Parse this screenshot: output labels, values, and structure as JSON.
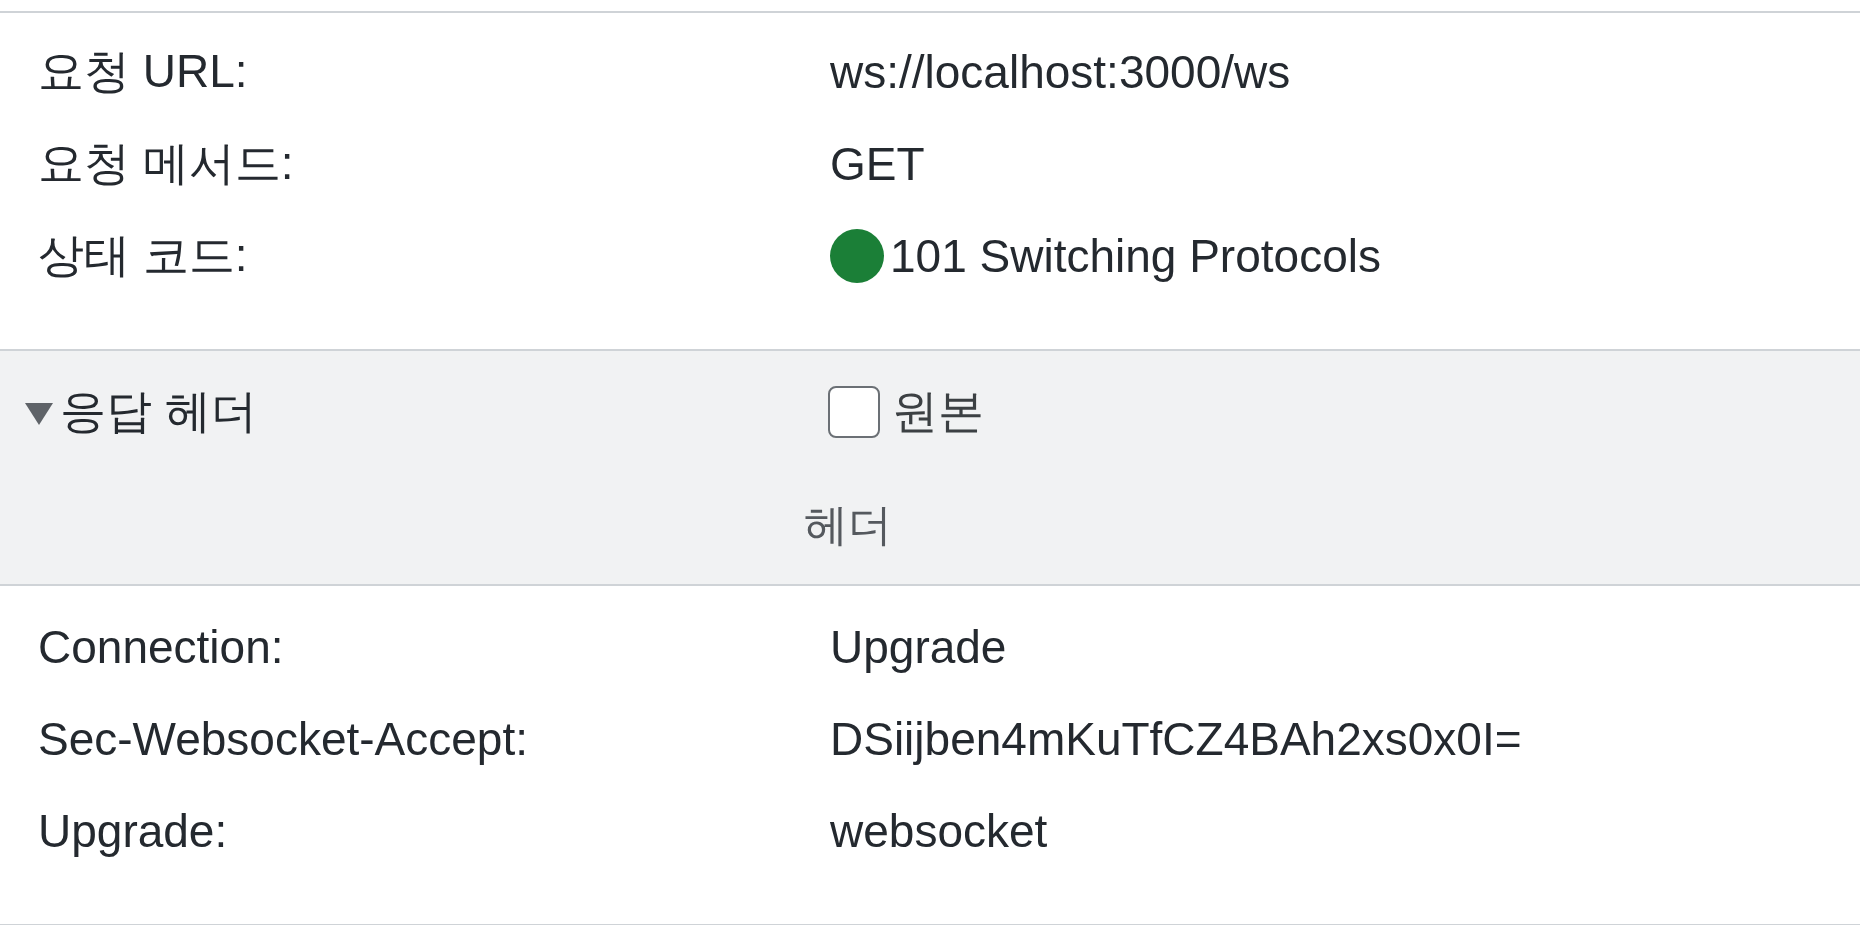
{
  "general": {
    "rows": [
      {
        "label": "요청 URL:",
        "value": "ws://localhost:3000/ws"
      },
      {
        "label": "요청 메서드:",
        "value": "GET"
      },
      {
        "label": "상태 코드:",
        "value": "101 Switching Protocols",
        "color": "#1b7f37"
      }
    ]
  },
  "response_headers": {
    "title": "응답 헤더",
    "expanded": true,
    "raw": {
      "label": "원본",
      "checked": false
    },
    "filter_label": "헤더",
    "rows": [
      {
        "label": "Connection:",
        "value": "Upgrade"
      },
      {
        "label": "Sec-Websocket-Accept:",
        "value": "DSiijben4mKuTfCZ4BAh2xs0x0I="
      },
      {
        "label": "Upgrade:",
        "value": "websocket"
      }
    ]
  }
}
